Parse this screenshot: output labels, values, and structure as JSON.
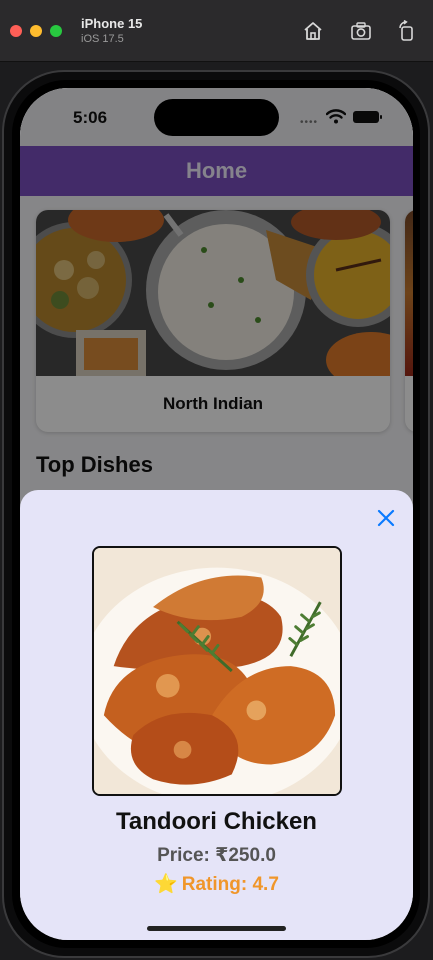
{
  "simulator": {
    "device_name": "iPhone 15",
    "os_version": "iOS 17.5",
    "icons": [
      "home-icon",
      "screenshot-icon",
      "rotate-icon"
    ]
  },
  "status_bar": {
    "time": "5:06",
    "signal": "••••",
    "icons": [
      "wifi-icon",
      "battery-icon"
    ]
  },
  "nav": {
    "title": "Home"
  },
  "cuisine_card": {
    "label": "North Indian",
    "image": "north-indian-thali-photo"
  },
  "section": {
    "title": "Top Dishes"
  },
  "dish_sheet": {
    "name": "Tandoori Chicken",
    "price": "Price: ₹250.0",
    "rating_icon": "⭐",
    "rating": "Rating: 4.7",
    "image": "tandoori-chicken-photo",
    "close_icon": "close-icon"
  },
  "colors": {
    "nav_bar": "#7b4fbf",
    "sheet_bg": "#e5e4f8",
    "rating_text": "#f0962a",
    "close_icon": "#0a7aff"
  }
}
